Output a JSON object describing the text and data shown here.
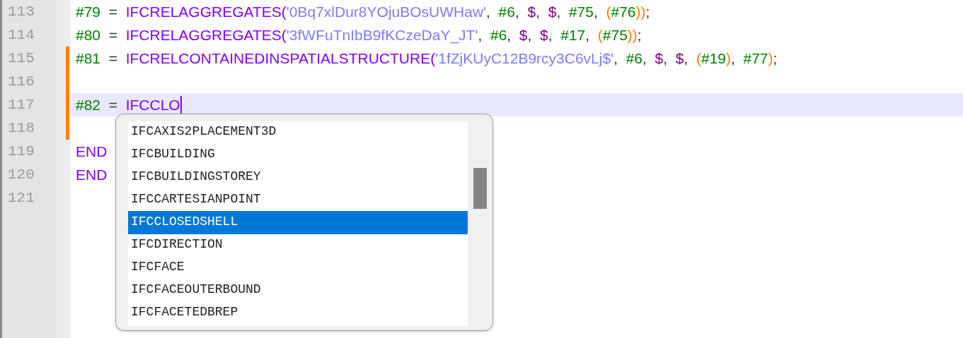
{
  "editor": {
    "lines": [
      {
        "number": "113",
        "modified": false,
        "current": false,
        "tokens": [
          {
            "kind": "ref",
            "text": "#79"
          },
          {
            "kind": "op",
            "text": "  =  "
          },
          {
            "kind": "keyword",
            "text": "IFCRELAGGREGATES"
          },
          {
            "kind": "keyword",
            "text": "("
          },
          {
            "kind": "string",
            "text": "'0Bq7xlDur8YOjuBOsUWHaw'"
          },
          {
            "kind": "op",
            "text": ",  "
          },
          {
            "kind": "ref",
            "text": "#6"
          },
          {
            "kind": "op",
            "text": ",  "
          },
          {
            "kind": "dollar",
            "text": "$"
          },
          {
            "kind": "op",
            "text": ",  "
          },
          {
            "kind": "dollar",
            "text": "$"
          },
          {
            "kind": "op",
            "text": ",  "
          },
          {
            "kind": "ref",
            "text": "#75"
          },
          {
            "kind": "op",
            "text": ",  "
          },
          {
            "kind": "paren",
            "text": "("
          },
          {
            "kind": "ref",
            "text": "#76"
          },
          {
            "kind": "paren",
            "text": "))"
          },
          {
            "kind": "op",
            "text": ";"
          }
        ]
      },
      {
        "number": "114",
        "modified": false,
        "current": false,
        "tokens": [
          {
            "kind": "ref",
            "text": "#80"
          },
          {
            "kind": "op",
            "text": "  =  "
          },
          {
            "kind": "keyword",
            "text": "IFCRELAGGREGATES"
          },
          {
            "kind": "keyword",
            "text": "("
          },
          {
            "kind": "string",
            "text": "'3fWFuTnIbB9fKCzeDaY_JT'"
          },
          {
            "kind": "op",
            "text": ",  "
          },
          {
            "kind": "ref",
            "text": "#6"
          },
          {
            "kind": "op",
            "text": ",  "
          },
          {
            "kind": "dollar",
            "text": "$"
          },
          {
            "kind": "op",
            "text": ",  "
          },
          {
            "kind": "dollar",
            "text": "$"
          },
          {
            "kind": "op",
            "text": ",  "
          },
          {
            "kind": "ref",
            "text": "#17"
          },
          {
            "kind": "op",
            "text": ",  "
          },
          {
            "kind": "paren",
            "text": "("
          },
          {
            "kind": "ref",
            "text": "#75"
          },
          {
            "kind": "paren",
            "text": "))"
          },
          {
            "kind": "op",
            "text": ";"
          }
        ]
      },
      {
        "number": "115",
        "modified": true,
        "current": false,
        "tokens": [
          {
            "kind": "ref",
            "text": "#81"
          },
          {
            "kind": "op",
            "text": "  =  "
          },
          {
            "kind": "keyword",
            "text": "IFCRELCONTAINEDINSPATIALSTRUCTURE"
          },
          {
            "kind": "keyword",
            "text": "("
          },
          {
            "kind": "string",
            "text": "'1fZjKUyC12B9rcy3C6vLj$'"
          },
          {
            "kind": "op",
            "text": ",  "
          },
          {
            "kind": "ref",
            "text": "#6"
          },
          {
            "kind": "op",
            "text": ",  "
          },
          {
            "kind": "dollar",
            "text": "$"
          },
          {
            "kind": "op",
            "text": ",  "
          },
          {
            "kind": "dollar",
            "text": "$"
          },
          {
            "kind": "op",
            "text": ",  "
          },
          {
            "kind": "paren",
            "text": "("
          },
          {
            "kind": "ref",
            "text": "#19"
          },
          {
            "kind": "paren",
            "text": ")"
          },
          {
            "kind": "op",
            "text": ",  "
          },
          {
            "kind": "ref",
            "text": "#77"
          },
          {
            "kind": "paren",
            "text": ")"
          },
          {
            "kind": "op",
            "text": ";"
          }
        ]
      },
      {
        "number": "116",
        "modified": true,
        "current": false
      },
      {
        "number": "117",
        "modified": true,
        "current": true,
        "tokens": [
          {
            "kind": "ref",
            "text": "#82"
          },
          {
            "kind": "op",
            "text": "  =  "
          },
          {
            "kind": "keyword",
            "text": "IFCCLO"
          }
        ]
      },
      {
        "number": "118",
        "modified": true,
        "current": false
      },
      {
        "number": "119",
        "modified": false,
        "current": false,
        "tokens": [
          {
            "kind": "keyword",
            "text": "END"
          }
        ]
      },
      {
        "number": "120",
        "modified": false,
        "current": false,
        "tokens": [
          {
            "kind": "keyword",
            "text": "END"
          }
        ]
      },
      {
        "number": "121",
        "modified": false,
        "current": false
      }
    ]
  },
  "autocomplete": {
    "items": [
      {
        "label": "IFCAXIS2PLACEMENT3D",
        "selected": false
      },
      {
        "label": "IFCBUILDING",
        "selected": false
      },
      {
        "label": "IFCBUILDINGSTOREY",
        "selected": false
      },
      {
        "label": "IFCCARTESIANPOINT",
        "selected": false
      },
      {
        "label": "IFCCLOSEDSHELL",
        "selected": true
      },
      {
        "label": "IFCDIRECTION",
        "selected": false
      },
      {
        "label": "IFCFACE",
        "selected": false
      },
      {
        "label": "IFCFACEOUTERBOUND",
        "selected": false
      },
      {
        "label": "IFCFACETEDBREP",
        "selected": false
      }
    ]
  }
}
